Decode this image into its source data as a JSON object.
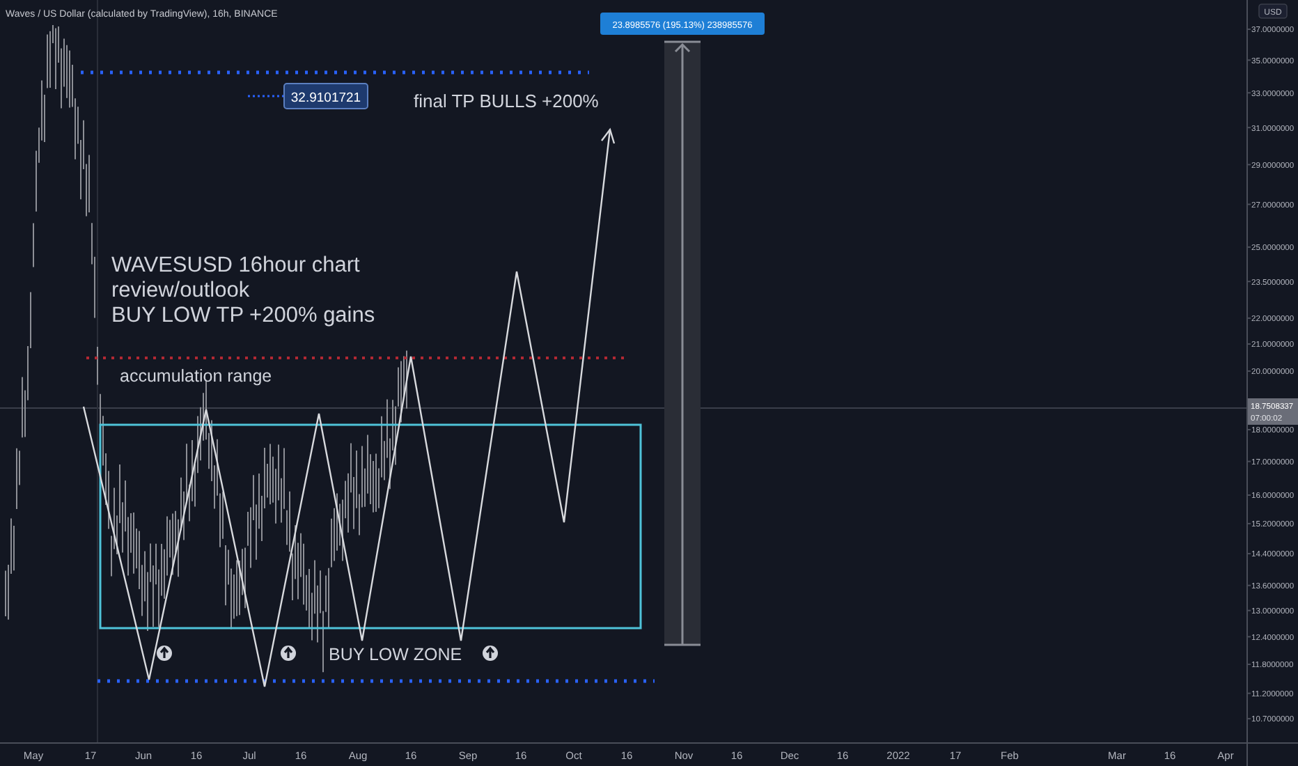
{
  "header": {
    "title": "Waves / US Dollar (calculated by TradingView), 16h, BINANCE"
  },
  "price_axis": {
    "currency": "USD",
    "labels": [
      "37.0000000",
      "35.0000000",
      "33.0000000",
      "31.0000000",
      "29.0000000",
      "27.0000000",
      "25.0000000",
      "23.5000000",
      "22.0000000",
      "21.0000000",
      "20.0000000",
      "18.0000000",
      "17.0000000",
      "16.0000000",
      "15.2000000",
      "14.4000000",
      "13.6000000",
      "13.0000000",
      "12.4000000",
      "11.8000000",
      "11.2000000",
      "10.7000000"
    ],
    "last_price": {
      "value": "18.7508337",
      "countdown": "07:00:02"
    }
  },
  "time_axis": {
    "labels": [
      "May",
      "17",
      "Jun",
      "16",
      "Jul",
      "16",
      "Aug",
      "16",
      "Sep",
      "16",
      "Oct",
      "16",
      "Nov",
      "16",
      "Dec",
      "16",
      "2022",
      "17",
      "Feb",
      "Mar",
      "16",
      "Apr"
    ]
  },
  "drawings": {
    "target_label": "32.9101721",
    "target_text": "final TP BULLS +200%",
    "note": [
      "WAVESUSD 16hour chart",
      "review/outlook",
      "BUY LOW TP +200% gains"
    ],
    "range_text": "accumulation range",
    "zone_text": "BUY LOW ZONE",
    "measure_label": "23.8985576 (195.13%) 238985576"
  }
}
